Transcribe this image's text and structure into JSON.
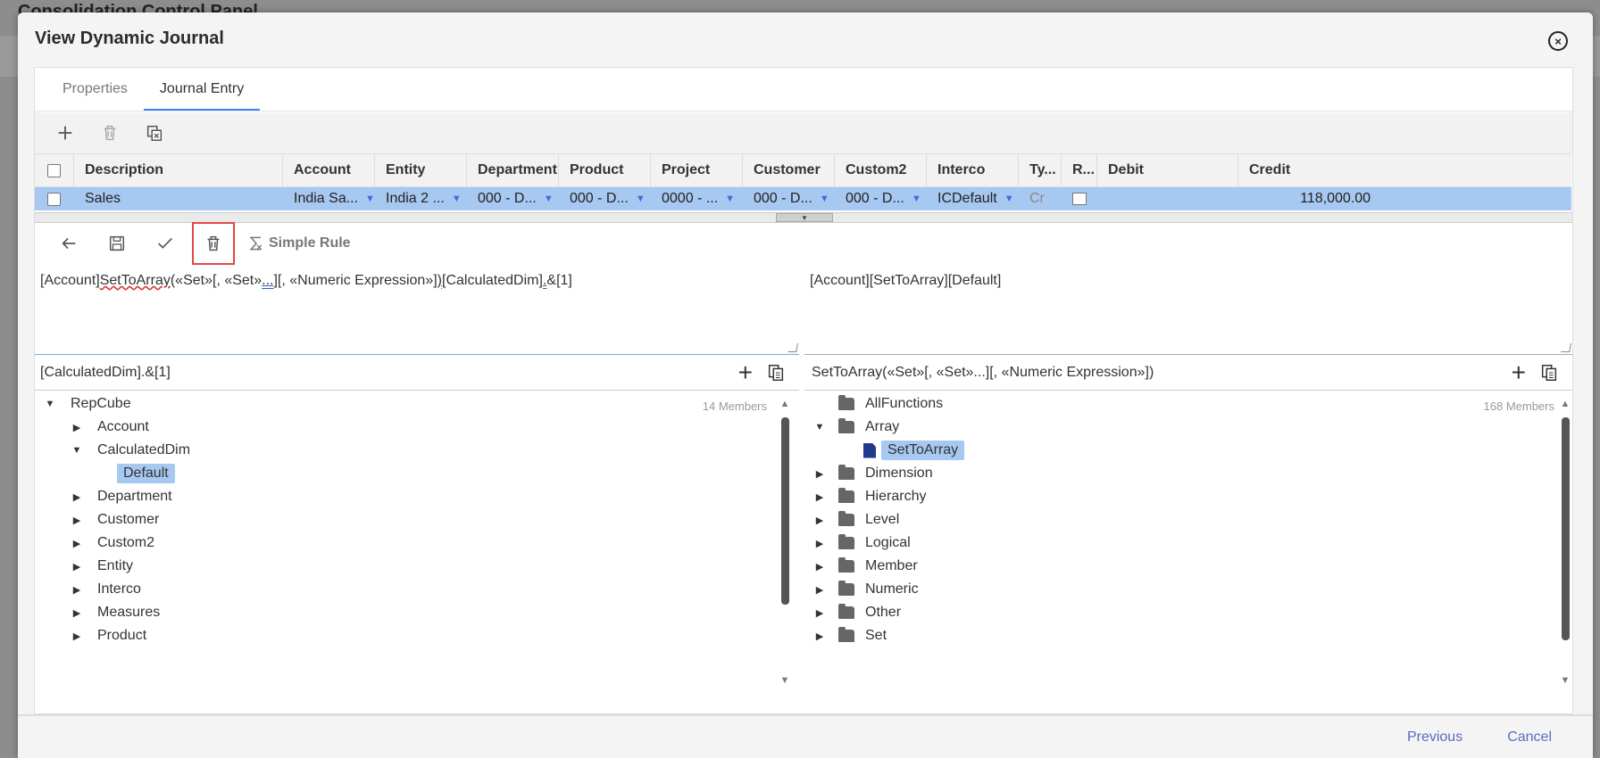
{
  "background": {
    "title": "Consolidation Control Panel"
  },
  "modal": {
    "title": "View Dynamic Journal",
    "close_icon": "×"
  },
  "tabs": [
    {
      "label": "Properties"
    },
    {
      "label": "Journal Entry"
    }
  ],
  "grid": {
    "headers": [
      "Description",
      "Account",
      "Entity",
      "Department",
      "Product",
      "Project",
      "Customer",
      "Custom2",
      "Interco",
      "Ty...",
      "R...",
      "Debit",
      "Credit"
    ],
    "row": {
      "description": "Sales",
      "account": "India Sa...",
      "entity": "India 2 ...",
      "department": "000 - D...",
      "product": "000 - D...",
      "project": "0000 - ...",
      "customer": "000 - D...",
      "custom2": "000 - D...",
      "interco": "ICDefault",
      "type": "Cr",
      "debit": "",
      "credit": "118,000.00"
    }
  },
  "toolbar2": {
    "simple_rule_label": "Simple Rule"
  },
  "expression": {
    "left": {
      "p1": "[Account]",
      "p2": "SetToArray",
      "p3": "(«Set»",
      "p4": "[",
      "p5": ", «Set»",
      "p6": "...",
      "p7": "][, «Numeric Expression»",
      "p8": "])",
      "p9": "[CalculatedDim]",
      "p10": ".",
      "p11": "&[1]"
    },
    "right": "[Account][SetToArray][Default]"
  },
  "left_panel": {
    "path": "[CalculatedDim].&[1]",
    "member_count": "14 Members",
    "tree": [
      {
        "label": "RepCube"
      },
      {
        "label": "Account"
      },
      {
        "label": "CalculatedDim"
      },
      {
        "label": "Default"
      },
      {
        "label": "Department"
      },
      {
        "label": "Customer"
      },
      {
        "label": "Custom2"
      },
      {
        "label": "Entity"
      },
      {
        "label": "Interco"
      },
      {
        "label": "Measures"
      },
      {
        "label": "Product"
      }
    ]
  },
  "right_panel": {
    "path": "SetToArray(«Set»[, «Set»...][, «Numeric Expression»])",
    "member_count": "168 Members",
    "tree": [
      {
        "label": "AllFunctions"
      },
      {
        "label": "Array"
      },
      {
        "label": "SetToArray"
      },
      {
        "label": "Dimension"
      },
      {
        "label": "Hierarchy"
      },
      {
        "label": "Level"
      },
      {
        "label": "Logical"
      },
      {
        "label": "Member"
      },
      {
        "label": "Numeric"
      },
      {
        "label": "Other"
      },
      {
        "label": "Set"
      }
    ]
  },
  "footer": {
    "previous_label": "Previous",
    "cancel_label": "Cancel"
  }
}
